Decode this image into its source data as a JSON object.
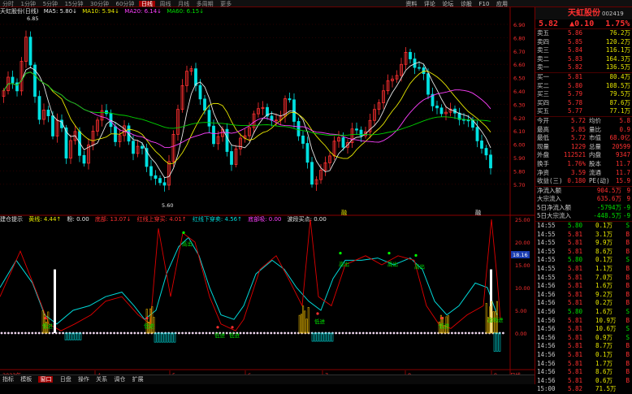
{
  "topbar": {
    "periods": [
      "分时",
      "1分钟",
      "5分钟",
      "15分钟",
      "30分钟",
      "60分钟",
      "日线",
      "周线",
      "月线",
      "多周期",
      "更多"
    ],
    "active": "日线",
    "right_items": [
      "资料",
      "评论",
      "论坛",
      "诊股",
      "F10",
      "应用"
    ]
  },
  "legend": {
    "name": "天虹股份(日线)",
    "ma5": "MA5: 5.80↓",
    "ma10": "MA10: 5.94↓",
    "ma20": "MA20: 6.14↓",
    "ma60": "MA60: 6.15↓"
  },
  "price_axis": {
    "labels": [
      "6.90",
      "6.80",
      "6.70",
      "6.60",
      "6.50",
      "6.40",
      "6.30",
      "6.20",
      "6.10",
      "6.00",
      "5.90",
      "5.80",
      "5.70"
    ],
    "hi_label": "6.85",
    "lo_label": "5.60"
  },
  "chart_markers": {
    "m1": "融",
    "m2": "融"
  },
  "ind_legend": {
    "name": "建仓提示",
    "a": "黄线: 4.44↑",
    "b": "粉: 0.00",
    "c": "底部: 13.07↓",
    "d": "红线上穿买: 4.01↑",
    "e": "红线下穿卖: 4.56↑",
    "f": "底部吸: 0.00",
    "g": "波段买点: 0.00"
  },
  "ind_axis": {
    "labels": [
      "25.00",
      "20.00",
      "15.00",
      "10.00",
      "5.00",
      "0.00"
    ],
    "current_value": "18.16"
  },
  "ind_labels": {
    "top": [
      "高出",
      "高出",
      "高出",
      "高出",
      "高出"
    ],
    "low": [
      "低进",
      "低进",
      "低进",
      "低进",
      "低进",
      "低进",
      "低进"
    ],
    "last": "出场进"
  },
  "date_axis": [
    "2023年",
    "4",
    "5",
    "6",
    "7",
    "8",
    "9",
    "日线"
  ],
  "header": {
    "stock_name": "天虹股份",
    "stock_code": "002419",
    "price": "5.82",
    "change": "▲0.10",
    "change_pct": "1.75%"
  },
  "order_book": {
    "asks": [
      {
        "label": "卖五",
        "price": "5.86",
        "vol": "76.2万"
      },
      {
        "label": "卖四",
        "price": "5.85",
        "vol": "120.2万"
      },
      {
        "label": "卖三",
        "price": "5.84",
        "vol": "116.1万"
      },
      {
        "label": "卖二",
        "price": "5.83",
        "vol": "164.3万"
      },
      {
        "label": "卖一",
        "price": "5.82",
        "vol": "136.5万"
      }
    ],
    "bids": [
      {
        "label": "买一",
        "price": "5.81",
        "vol": "80.4万"
      },
      {
        "label": "买二",
        "price": "5.80",
        "vol": "108.5万"
      },
      {
        "label": "买三",
        "price": "5.79",
        "vol": "79.5万"
      },
      {
        "label": "买四",
        "price": "5.78",
        "vol": "87.6万"
      },
      {
        "label": "买五",
        "price": "5.77",
        "vol": "77.1万"
      }
    ]
  },
  "stats": [
    {
      "l1": "今开",
      "v1": "5.72",
      "l2": "均价",
      "v2": "5.8"
    },
    {
      "l1": "最高",
      "v1": "5.85",
      "l2": "量比",
      "v2": "0.9"
    },
    {
      "l1": "最低",
      "v1": "5.72",
      "l2": "市值",
      "v2": "68.0亿"
    },
    {
      "l1": "现量",
      "v1": "1229",
      "l2": "总量",
      "v2": "20599"
    },
    {
      "l1": "外盘",
      "v1": "112521",
      "l2": "内盘",
      "v2": "9347"
    },
    {
      "l1": "换手",
      "v1": "1.76%",
      "l2": "股本",
      "v2": "11.7"
    },
    {
      "l1": "净资",
      "v1": "3.59",
      "l2": "流通",
      "v2": "11.7"
    },
    {
      "l1": "收益(三)",
      "v1": "0.180",
      "l2": "PE(动)",
      "v2": "15.9"
    }
  ],
  "flow": [
    {
      "label": "净流入额",
      "val": "904.5万",
      "ex": "9"
    },
    {
      "label": "大宗流入",
      "val": "635.6万",
      "ex": "9"
    },
    {
      "label": "5日净流入额",
      "val": "-5794万",
      "ex": "-9"
    },
    {
      "label": "5日大宗流入",
      "val": "-448.5万",
      "ex": "-9"
    }
  ],
  "ticks": [
    {
      "t": "14:55",
      "p": "5.80",
      "v": "0.1万",
      "s": "S"
    },
    {
      "t": "14:55",
      "p": "5.81",
      "v": "3.1万",
      "s": "B"
    },
    {
      "t": "14:55",
      "p": "5.81",
      "v": "9.9万",
      "s": "B"
    },
    {
      "t": "14:55",
      "p": "5.81",
      "v": "8.6万",
      "s": "B"
    },
    {
      "t": "14:55",
      "p": "5.80",
      "v": "0.1万",
      "s": "S"
    },
    {
      "t": "14:55",
      "p": "5.81",
      "v": "1.1万",
      "s": "B"
    },
    {
      "t": "14:55",
      "p": "5.81",
      "v": "7.0万",
      "s": "B"
    },
    {
      "t": "14:56",
      "p": "5.81",
      "v": "1.6万",
      "s": "B"
    },
    {
      "t": "14:56",
      "p": "5.81",
      "v": "9.2万",
      "s": "B"
    },
    {
      "t": "14:56",
      "p": "5.81",
      "v": "0.2万",
      "s": "B"
    },
    {
      "t": "14:56",
      "p": "5.80",
      "v": "1.6万",
      "s": "S"
    },
    {
      "t": "14:56",
      "p": "5.81",
      "v": "10.9万",
      "s": "B"
    },
    {
      "t": "14:56",
      "p": "5.81",
      "v": "10.6万",
      "s": "S"
    },
    {
      "t": "14:56",
      "p": "5.81",
      "v": "0.9万",
      "s": "S"
    },
    {
      "t": "14:56",
      "p": "5.81",
      "v": "8.7万",
      "s": "B"
    },
    {
      "t": "14:56",
      "p": "5.81",
      "v": "0.1万",
      "s": "B"
    },
    {
      "t": "14:56",
      "p": "5.81",
      "v": "1.7万",
      "s": "B"
    },
    {
      "t": "14:56",
      "p": "5.81",
      "v": "8.6万",
      "s": "B"
    },
    {
      "t": "14:56",
      "p": "5.81",
      "v": "0.6万",
      "s": "B"
    },
    {
      "t": "15:00",
      "p": "5.82",
      "v": "71.5万",
      "s": ""
    }
  ],
  "bottom_bar": {
    "items": [
      "指标",
      "模板",
      "窗口",
      "日盘",
      "操作",
      "关系",
      "调仓",
      "扩展"
    ],
    "active": "窗口"
  }
}
